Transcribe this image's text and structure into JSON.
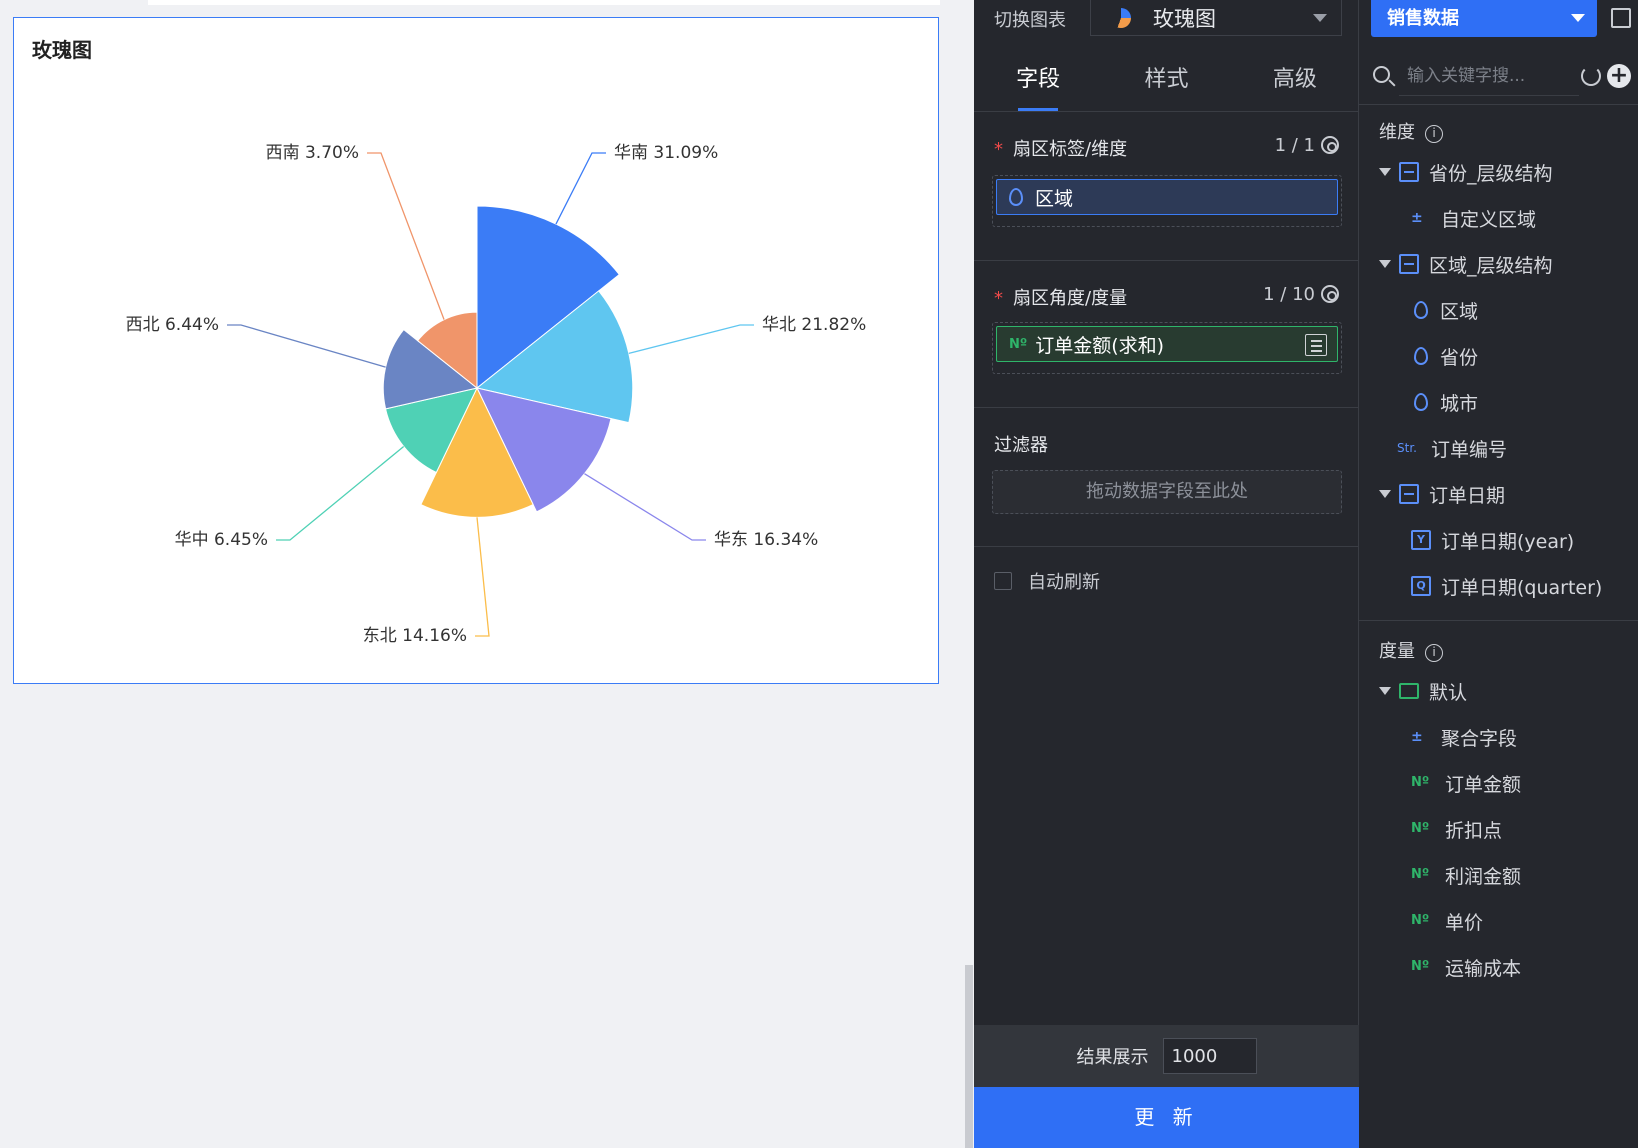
{
  "chart_card": {
    "title": "玫瑰图"
  },
  "chart_data": {
    "type": "pie",
    "variant": "rose",
    "title": "玫瑰图",
    "slices": [
      {
        "label": "华南",
        "percent": 31.09,
        "color": "#3b7cf6"
      },
      {
        "label": "华北",
        "percent": 21.82,
        "color": "#5fc6f0"
      },
      {
        "label": "华东",
        "percent": 16.34,
        "color": "#8a86ec"
      },
      {
        "label": "东北",
        "percent": 14.16,
        "color": "#fbbd4a"
      },
      {
        "label": "华中",
        "percent": 6.45,
        "color": "#4fd1b5"
      },
      {
        "label": "西北",
        "percent": 6.44,
        "color": "#6a85c4"
      },
      {
        "label": "西南",
        "percent": 3.7,
        "color": "#f0956a"
      }
    ],
    "display_labels": [
      "华南 31.09%",
      "华北 21.82%",
      "华东 16.34%",
      "东北 14.16%",
      "华中 6.45%",
      "西北 6.44%",
      "西南 3.70%"
    ]
  },
  "config": {
    "switch_label": "切换图表",
    "chart_type": "玫瑰图",
    "tabs": [
      "字段",
      "样式",
      "高级"
    ],
    "active_tab": "字段",
    "sector_label": {
      "title": "扇区标签/维度",
      "count": "1 / 1",
      "field": "区域"
    },
    "sector_angle": {
      "title": "扇区角度/度量",
      "count": "1 / 10",
      "field": "订单金额(求和)"
    },
    "filter": {
      "title": "过滤器",
      "placeholder": "拖动数据字段至此处"
    },
    "auto_refresh": "自动刷新",
    "result_label": "结果展示",
    "result_value": "1000",
    "update_button": "更 新"
  },
  "fields_panel": {
    "dataset": "销售数据",
    "search_placeholder": "输入关键字搜...",
    "dimension_title": "维度",
    "dimensions": [
      {
        "label": "省份_层级结构",
        "icon": "hierarchy-icon",
        "level": 0
      },
      {
        "label": "自定义区域",
        "icon": "calc-icon",
        "level": 1
      },
      {
        "label": "区域_层级结构",
        "icon": "hierarchy-icon",
        "level": 0
      },
      {
        "label": "区域",
        "icon": "location-icon",
        "level": 1
      },
      {
        "label": "省份",
        "icon": "location-icon",
        "level": 1
      },
      {
        "label": "城市",
        "icon": "location-icon",
        "level": 1
      },
      {
        "label": "订单编号",
        "icon": "string-icon",
        "level": 0
      },
      {
        "label": "订单日期",
        "icon": "hierarchy-icon",
        "level": 0
      },
      {
        "label": "订单日期(year)",
        "icon": "year-icon",
        "level": 1
      },
      {
        "label": "订单日期(quarter)",
        "icon": "quarter-icon",
        "level": 1
      }
    ],
    "measure_title": "度量",
    "measures": [
      {
        "label": "默认",
        "icon": "folder-icon",
        "level": 0
      },
      {
        "label": "聚合字段",
        "icon": "calc-icon",
        "level": 1
      },
      {
        "label": "订单金额",
        "icon": "number-icon",
        "level": 1
      },
      {
        "label": "折扣点",
        "icon": "number-icon",
        "level": 1
      },
      {
        "label": "利润金额",
        "icon": "number-icon",
        "level": 1
      },
      {
        "label": "单价",
        "icon": "number-icon",
        "level": 1
      },
      {
        "label": "运输成本",
        "icon": "number-icon",
        "level": 1
      }
    ]
  }
}
